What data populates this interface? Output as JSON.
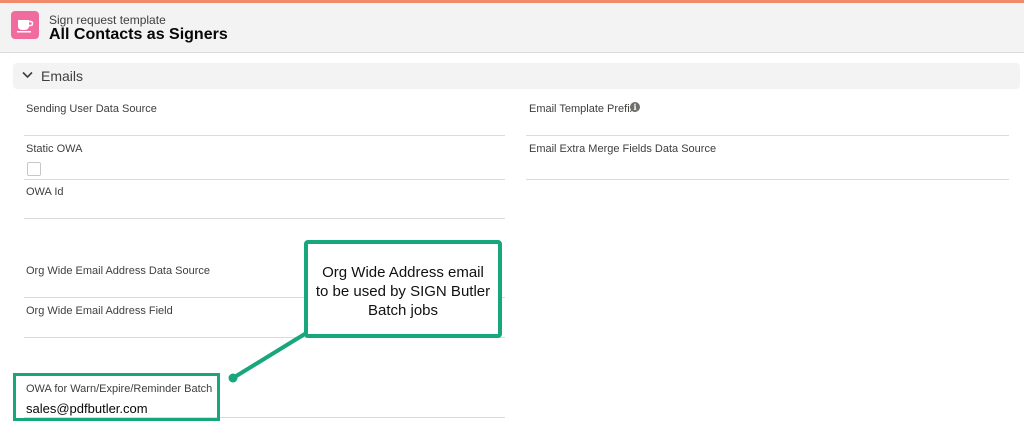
{
  "header": {
    "subtitle": "Sign request template",
    "title": "All Contacts as Signers"
  },
  "section": {
    "title": "Emails"
  },
  "fields": {
    "sending_user_data_source": {
      "label": "Sending User Data Source",
      "value": ""
    },
    "email_template_prefix": {
      "label": "Email Template Prefix",
      "value": ""
    },
    "static_owa": {
      "label": "Static OWA",
      "checked": false
    },
    "email_extra_merge_fields_data_source": {
      "label": "Email Extra Merge Fields Data Source",
      "value": ""
    },
    "owa_id": {
      "label": "OWA Id",
      "value": ""
    },
    "org_wide_email_address_data_source": {
      "label": "Org Wide Email Address Data Source",
      "value": ""
    },
    "org_wide_email_address_field": {
      "label": "Org Wide Email Address Field",
      "value": ""
    },
    "owa_for_warn_expire_reminder_batch": {
      "label": "OWA for Warn/Expire/Reminder Batch",
      "value": "sales@pdfbutler.com"
    }
  },
  "annotation": {
    "callout_line1": "Org Wide Address email",
    "callout_line2": "to be used by SIGN Butler",
    "callout_line3": "Batch jobs"
  },
  "icons": {
    "app_icon": "coffee-cup-icon",
    "section_toggle": "chevron-down-icon",
    "help": "info-icon"
  },
  "colors": {
    "app_icon_bg": "#f06c9f",
    "annotation": "#18a67d",
    "top_accent": "#f08a6b"
  }
}
